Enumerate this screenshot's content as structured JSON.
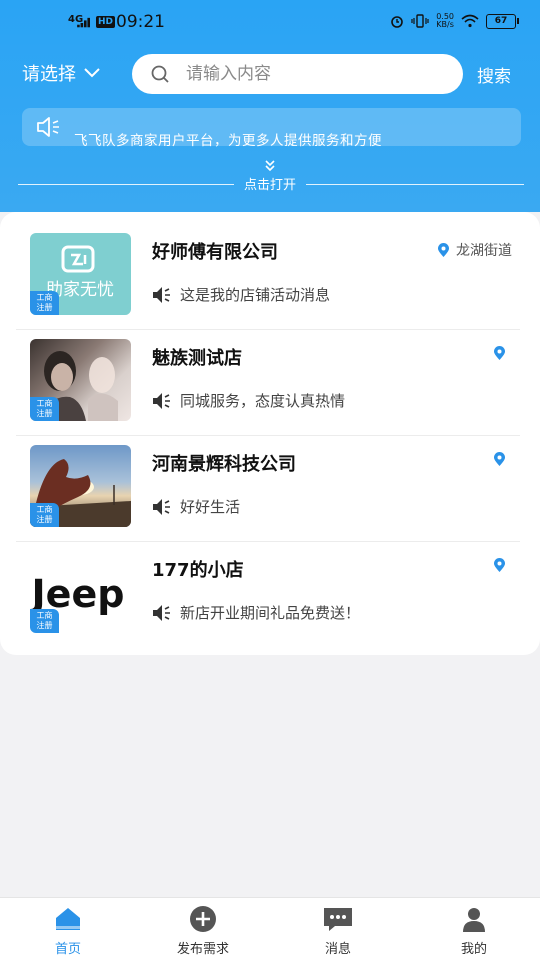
{
  "status_bar": {
    "network": "4G",
    "hd": "HD",
    "time": "09:21",
    "speed_value": "0.50",
    "speed_unit": "KB/s",
    "battery": "67"
  },
  "header": {
    "location_select": "请选择",
    "search_placeholder": "请输入内容",
    "search_button": "搜索",
    "notice": "飞飞队多商家用户平台，为更多人提供服务和方便",
    "expand_label": "点击打开"
  },
  "shops": [
    {
      "name": "好师傅有限公司",
      "location": "龙湖街道",
      "message": "这是我的店铺活动消息",
      "badge": [
        "工商",
        "注册"
      ],
      "thumb_text": "助家无忧"
    },
    {
      "name": "魅族测试店",
      "location": "",
      "message": "同城服务，态度认真热情",
      "badge": [
        "工商",
        "注册"
      ]
    },
    {
      "name": "河南景辉科技公司",
      "location": "",
      "message": "好好生活",
      "badge": [
        "工商",
        "注册"
      ]
    },
    {
      "name": "177的小店",
      "location": "",
      "message": "新店开业期间礼品免费送！",
      "badge": [
        "工商",
        "注册"
      ],
      "thumb_text": "Jeep"
    }
  ],
  "tabbar": {
    "items": [
      {
        "label": "首页",
        "active": true
      },
      {
        "label": "发布需求",
        "active": false
      },
      {
        "label": "消息",
        "active": false
      },
      {
        "label": "我的",
        "active": false
      }
    ]
  },
  "colors": {
    "primary": "#2aa4f4",
    "accent": "#2a92e8"
  }
}
